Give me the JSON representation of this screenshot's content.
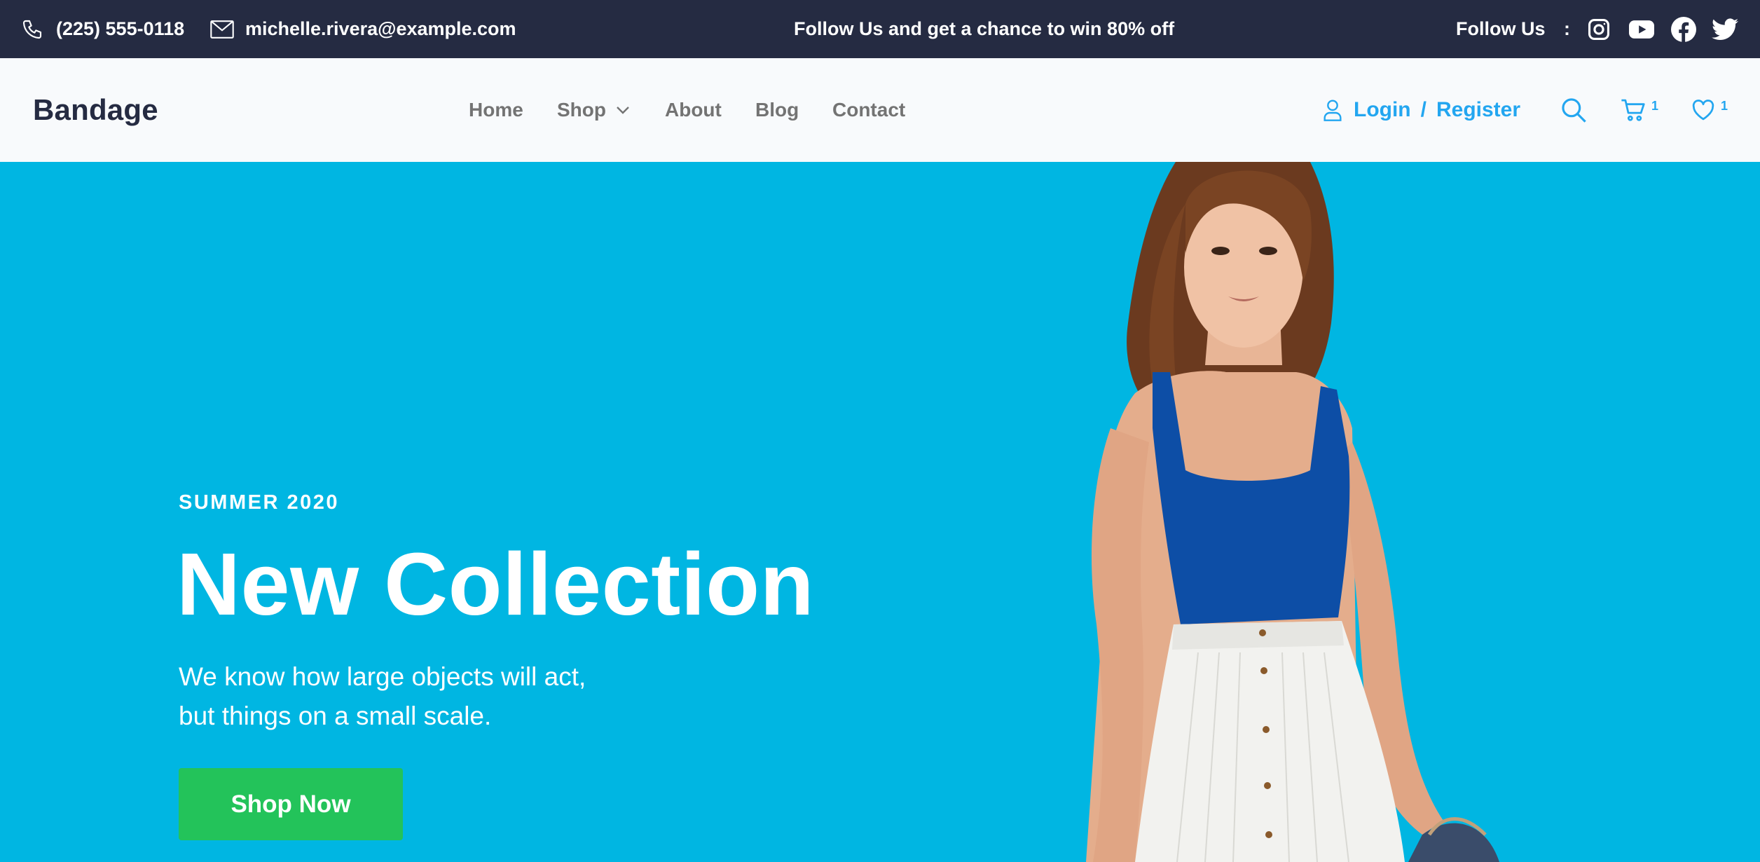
{
  "topbar": {
    "phone": "(225) 555-0118",
    "email": "michelle.rivera@example.com",
    "promo": "Follow Us  and get a chance to win 80% off",
    "follow_label": "Follow Us",
    "colon": ":",
    "social": [
      {
        "icon": "instagram-icon"
      },
      {
        "icon": "youtube-icon"
      },
      {
        "icon": "facebook-icon"
      },
      {
        "icon": "twitter-icon"
      }
    ]
  },
  "nav": {
    "brand": "Bandage",
    "links": [
      "Home",
      "Shop",
      "About",
      "Blog",
      "Contact"
    ],
    "login": "Login",
    "separator": "/",
    "register": "Register",
    "cart_count": "1",
    "wishlist_count": "1"
  },
  "hero": {
    "season": "SUMMER 2020",
    "title": "New Collection",
    "desc_line1": "We know how large objects will act,",
    "desc_line2": "but things on a small scale.",
    "cta": "Shop Now"
  },
  "colors": {
    "topbar_bg": "#252b42",
    "navbar_bg": "#f8fafc",
    "accent": "#23a6f0",
    "hero_bg": "#00b6e2",
    "cta_bg": "#23c35a",
    "nav_text": "#737373"
  }
}
